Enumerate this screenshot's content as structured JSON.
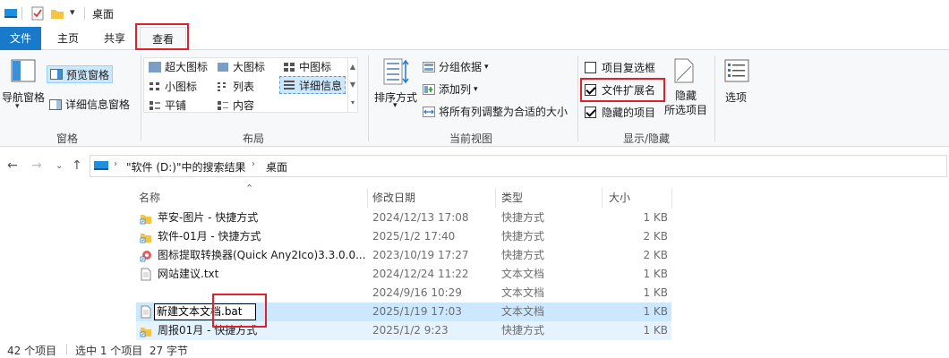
{
  "titlebar": {
    "title": "桌面",
    "qat_dropdown": "▾"
  },
  "tabs": {
    "file": "文件",
    "home": "主页",
    "share": "共享",
    "view": "查看"
  },
  "ribbon": {
    "panes": {
      "nav_pane": "导航窗格",
      "preview_pane": "预览窗格",
      "details_pane": "详细信息窗格",
      "label": "窗格"
    },
    "layout": {
      "items": [
        "超大图标",
        "大图标",
        "中图标",
        "小图标",
        "列表",
        "详细信息",
        "平铺",
        "内容"
      ],
      "selected": "详细信息",
      "label": "布局"
    },
    "current_view": {
      "sort": "排序方式",
      "group": "分组依据",
      "add_column": "添加列",
      "fit_columns": "将所有列调整为合适的大小",
      "label": "当前视图"
    },
    "show_hide": {
      "item_checkboxes": {
        "label": "项目复选框",
        "checked": false
      },
      "file_extensions": {
        "label": "文件扩展名",
        "checked": true
      },
      "hidden_items": {
        "label": "隐藏的项目",
        "checked": true
      },
      "hide_selected": "隐藏\n所选项目",
      "hide_line1": "隐藏",
      "hide_line2": "所选项目",
      "label": "显示/隐藏"
    },
    "options": "选项"
  },
  "address": {
    "path_part1": "\"软件 (D:)\"中的搜索结果",
    "path_part2": "桌面",
    "sep": "›"
  },
  "columns": {
    "name": "名称",
    "modified": "修改日期",
    "type": "类型",
    "size": "大小"
  },
  "files": [
    {
      "name": "苹安-图片 - 快捷方式",
      "modified": "2024/12/13 17:08",
      "type": "快捷方式",
      "size": "1 KB"
    },
    {
      "name": "软件-01月 - 快捷方式",
      "modified": "2025/1/2 17:40",
      "type": "快捷方式",
      "size": "2 KB"
    },
    {
      "name": "图标提取转换器(Quick Any2Ico)3.3.0.0...",
      "modified": "2023/10/19 17:27",
      "type": "快捷方式",
      "size": "2 KB"
    },
    {
      "name": "网站建议.txt",
      "modified": "2024/12/24 11:22",
      "type": "文本文档",
      "size": "1 KB"
    },
    {
      "name": "",
      "modified": "2024/9/16 10:29",
      "type": "文本文档",
      "size": "1 KB"
    },
    {
      "name": "新建文本文档.bat",
      "modified": "2025/1/19 17:03",
      "type": "文本文档",
      "size": "1 KB"
    },
    {
      "name": "周报01月 - 快捷方式",
      "modified": "2025/1/2 9:23",
      "type": "快捷方式",
      "size": "1 KB"
    }
  ],
  "status": {
    "count": "42 个项目",
    "selected": "选中 1 个项目  27 字节"
  }
}
